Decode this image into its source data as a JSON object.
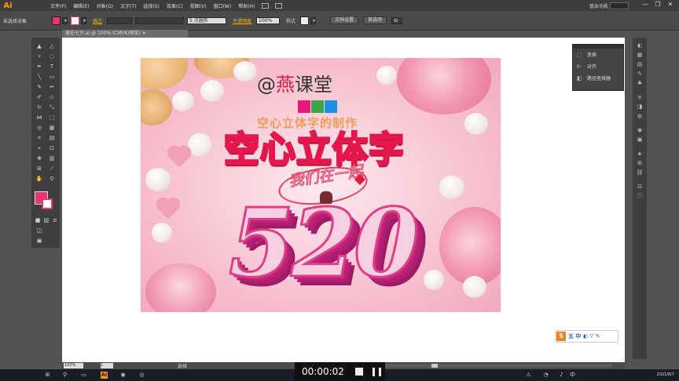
{
  "menubar": {
    "logo": "Ai",
    "items": [
      "文件(F)",
      "编辑(E)",
      "对象(O)",
      "文字(T)",
      "选择(S)",
      "效果(C)",
      "视图(V)",
      "窗口(W)",
      "帮助(H)"
    ],
    "workspace": "基本功能",
    "window_controls": [
      "—",
      "❐",
      "✕"
    ]
  },
  "controlbar": {
    "selection": "未选择对象",
    "stroke_label": "描边",
    "stroke_size": "5 点圆形",
    "opacity_label": "不透明度",
    "opacity_value": "100%",
    "style_label": "样式",
    "doc_setup": "文档设置",
    "preferences": "首选项",
    "fill_color": "#e8386a"
  },
  "document_tab": "爱在七夕.ai @ 100% (CMYK/预览) ✕",
  "artwork": {
    "brand_at": "@",
    "brand_main": "燕",
    "brand_rest": "课堂",
    "square_colors": [
      "#e6197a",
      "#3aa648",
      "#1e8fe0"
    ],
    "subtitle": "空心立体字的制作",
    "main_title": "空心立体字",
    "script": "我们在一起",
    "number": "520"
  },
  "flyout": {
    "items": [
      {
        "icon": "transform-icon",
        "label": "变换"
      },
      {
        "icon": "align-icon",
        "label": "对齐"
      },
      {
        "icon": "pathfinder-icon",
        "label": "路径查找器"
      }
    ]
  },
  "statusbar": {
    "zoom": "100%",
    "page": "1",
    "mode": "选择"
  },
  "watermark": {
    "logo": "S",
    "text": "五 中 ◐ ∵ ✎"
  },
  "video": {
    "time": "00:00:02"
  },
  "taskbar": {
    "clock": "2021/8/7"
  }
}
